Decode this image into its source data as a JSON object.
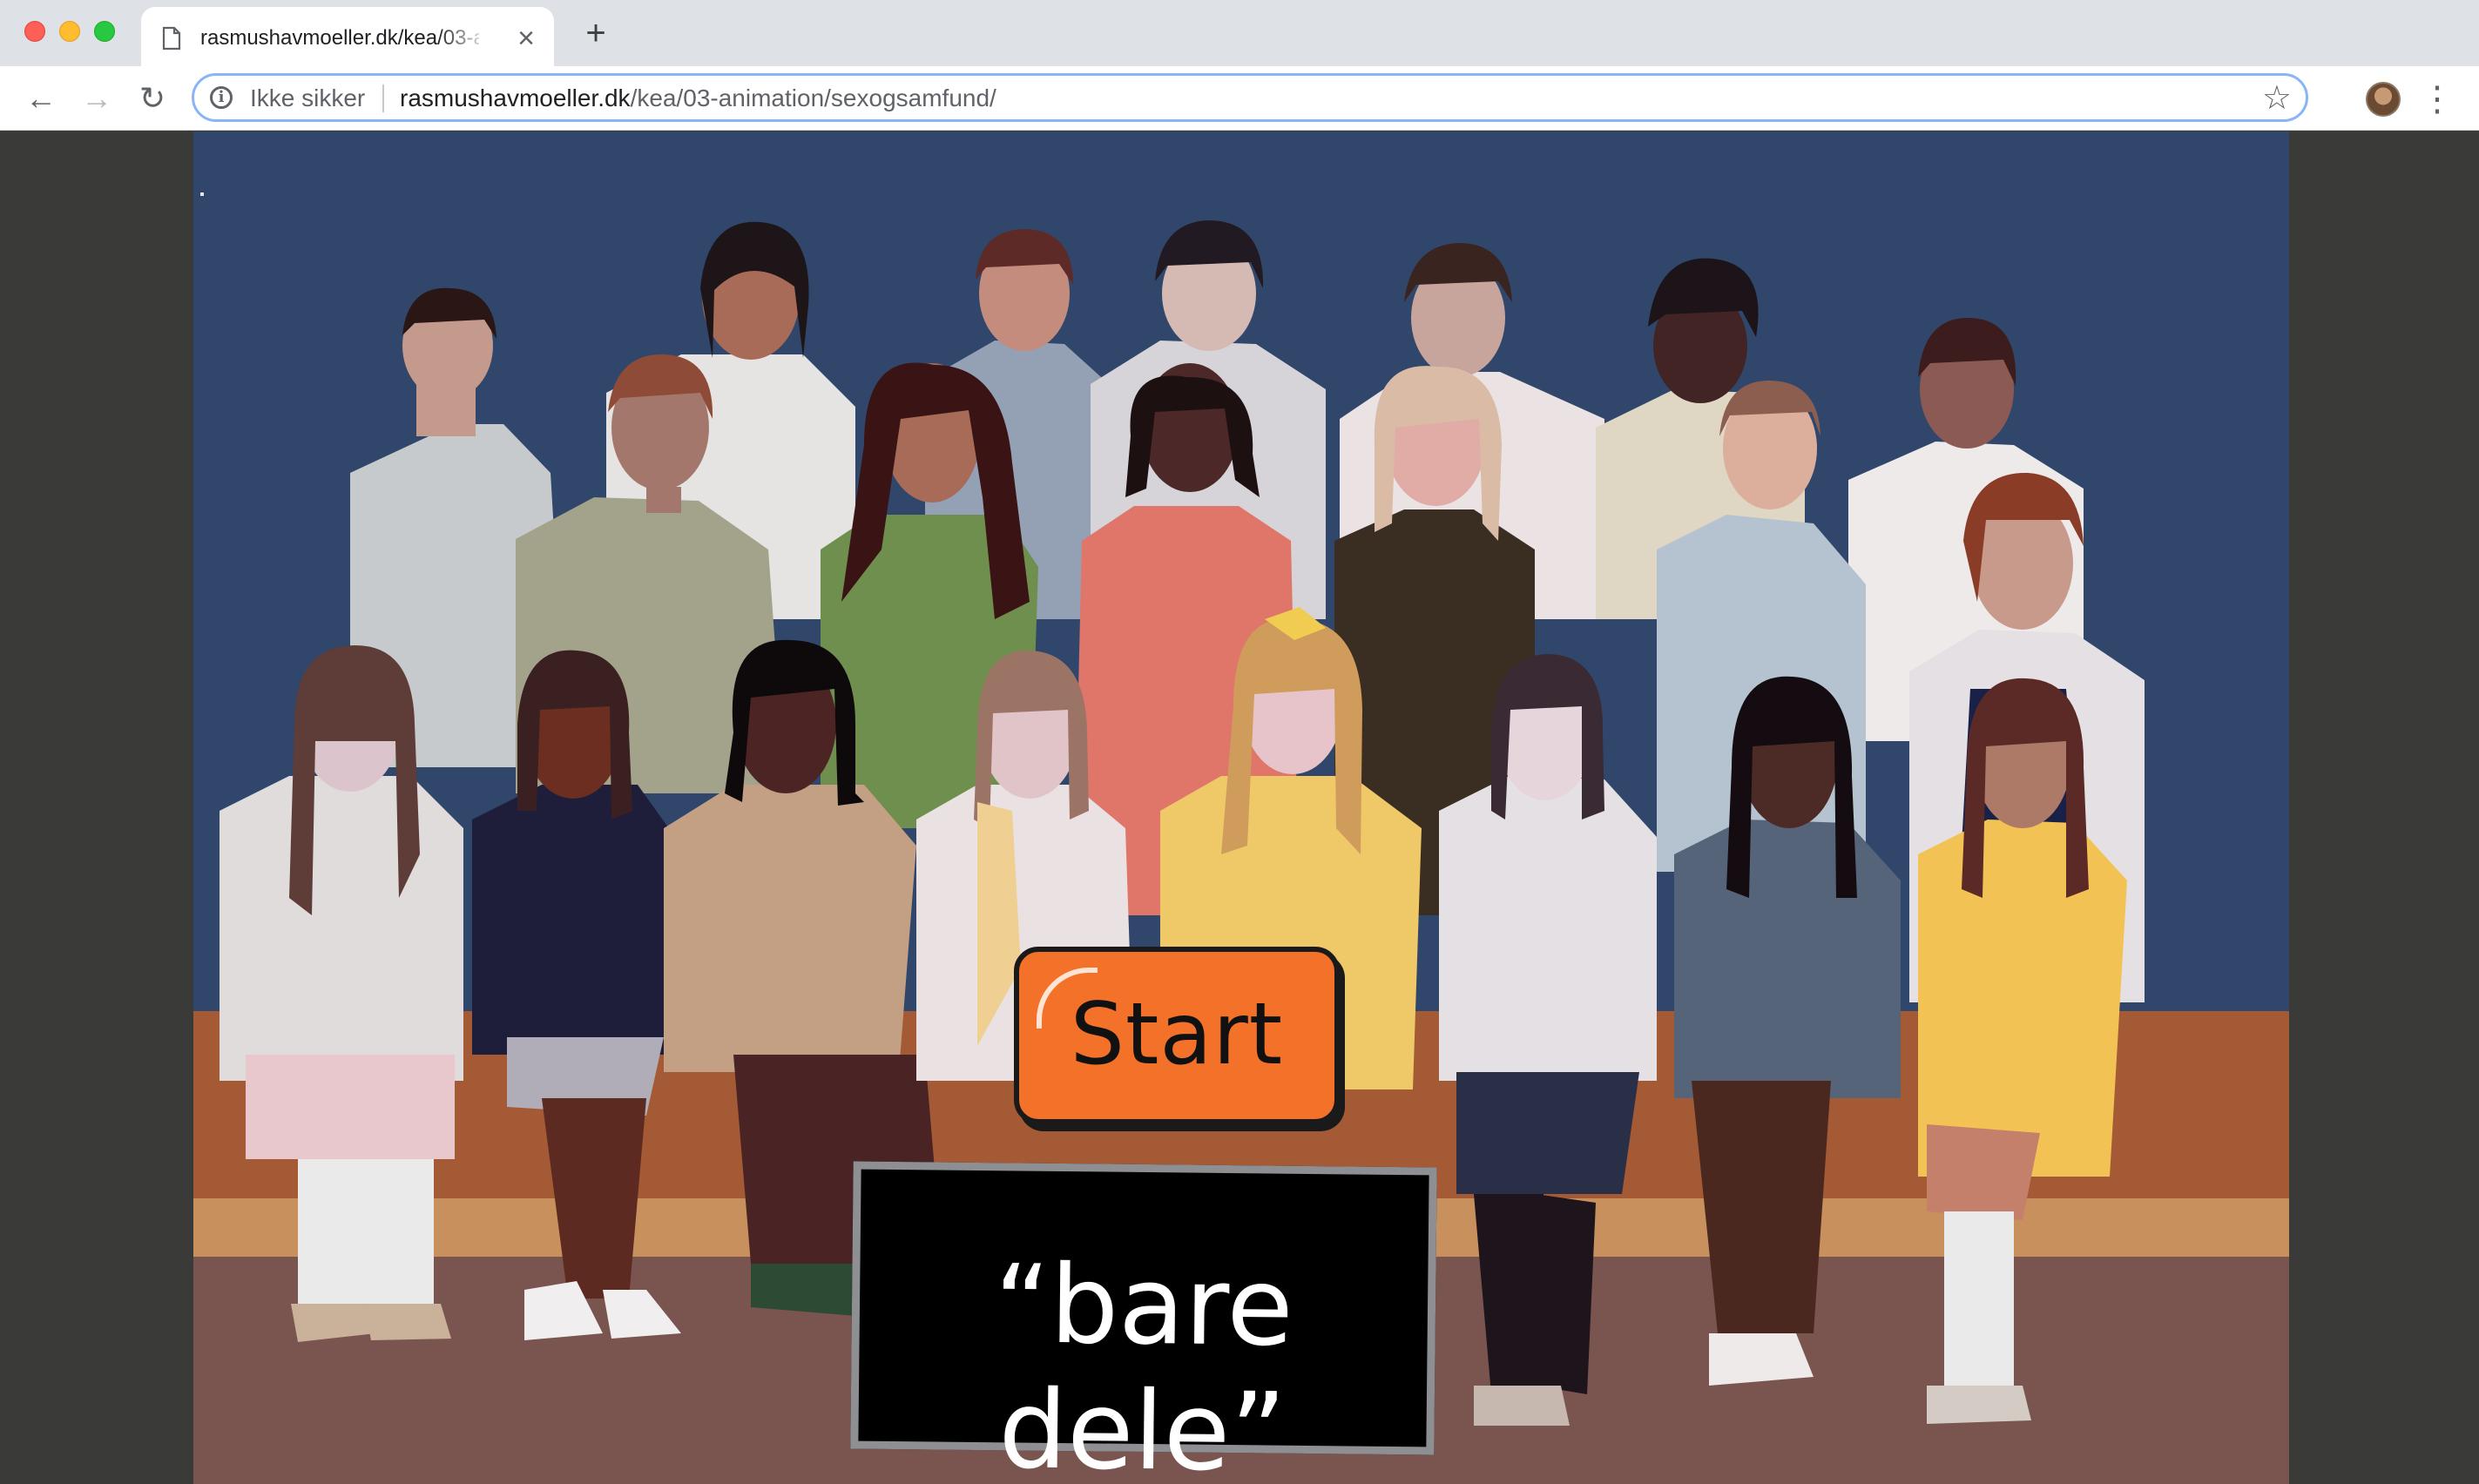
{
  "browser": {
    "tab_title": "rasmushavmoeller.dk/kea/03-animation/sexogsamfund/",
    "tab_close": "×",
    "new_tab": "+",
    "nav": {
      "back": "←",
      "forward": "→",
      "reload": "↻"
    },
    "security_label": "Ikke sikker",
    "url_host": "rasmushavmoeller.dk",
    "url_path": "/kea/03-animation/sexogsamfund/",
    "star": "☆",
    "menu": "⋮"
  },
  "page": {
    "start_button": "Start",
    "sign_text": "“bare dele”",
    "colors": {
      "background": "#30466b",
      "stage_top": "#a45a34",
      "bench": "#c8905c",
      "floor": "#7a5550",
      "button": "#f37128",
      "sign": "#000000"
    },
    "illustration": "class-photo-illustration"
  }
}
